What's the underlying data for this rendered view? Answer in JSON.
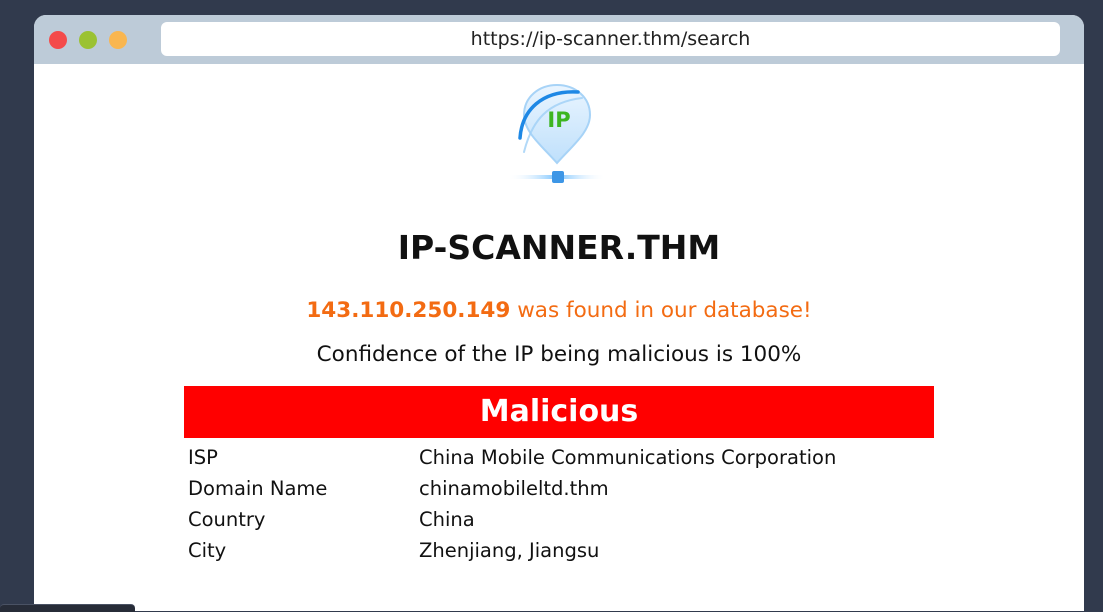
{
  "browser": {
    "url": "https://ip-scanner.thm/search",
    "controls": [
      "close",
      "minimize",
      "maximize"
    ]
  },
  "site": {
    "logo_text": "IP",
    "title": "IP-SCANNER.THM"
  },
  "result": {
    "ip": "143.110.250.149",
    "found_text": "was found in our database!",
    "confidence_text": "Confidence of the IP being malicious is 100%",
    "confidence_value": 100,
    "verdict": "Malicious",
    "verdict_color": "#ff0000",
    "rows": [
      {
        "label": "ISP",
        "value": "China Mobile Communications Corporation"
      },
      {
        "label": "Domain Name",
        "value": "chinamobileltd.thm"
      },
      {
        "label": "Country",
        "value": "China"
      },
      {
        "label": "City",
        "value": "Zhenjiang, Jiangsu"
      }
    ]
  },
  "colors": {
    "accent_orange": "#f36b12",
    "background": "#313a4d",
    "titlebar": "#bdcbd8"
  }
}
